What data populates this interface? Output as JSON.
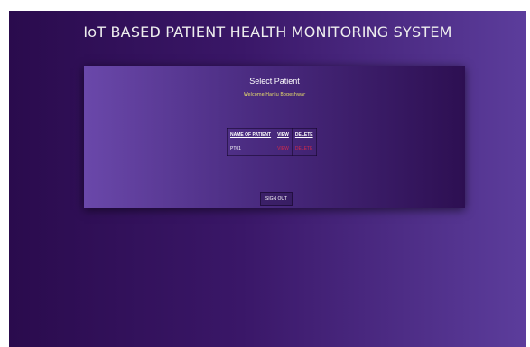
{
  "app": {
    "title": "IoT BASED PATIENT HEALTH MONITORING SYSTEM"
  },
  "card": {
    "title": "Select Patient",
    "welcome": "Welcome Hanju Bogeshwar",
    "table": {
      "headers": [
        "NAME OF PATIENT",
        "VIEW",
        "DELETE"
      ],
      "rows": [
        {
          "patient": "PT01",
          "view": "VIEW",
          "delete": "DELETE"
        }
      ]
    },
    "signout_label": "SIGN OUT"
  },
  "colors": {
    "background_dark": "#2a0b4d",
    "background_light": "#5c3d9c",
    "welcome_text": "#e8df6a",
    "link_red": "#d62a4a"
  }
}
